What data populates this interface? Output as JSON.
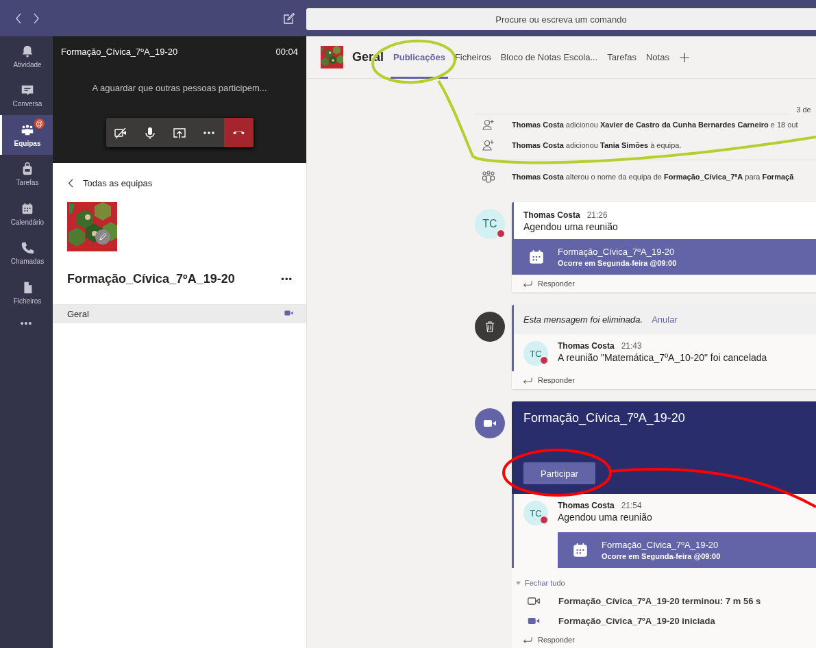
{
  "search": {
    "placeholder": "Procure ou escreva um comando"
  },
  "rail": {
    "items": [
      {
        "label": "Atividade",
        "selected": false
      },
      {
        "label": "Conversa",
        "selected": false
      },
      {
        "label": "Equipas",
        "selected": true,
        "badge": "@"
      },
      {
        "label": "Tarefas",
        "selected": false
      },
      {
        "label": "Calendário",
        "selected": false
      },
      {
        "label": "Chamadas",
        "selected": false
      },
      {
        "label": "Ficheiros",
        "selected": false
      }
    ],
    "more": "•••"
  },
  "call": {
    "title": "Formação_Cívica_7ºA_19-20",
    "timer": "00:04",
    "status": "A aguardar que outras pessoas participem..."
  },
  "team": {
    "back": "Todas as equipas",
    "name": "Formação_Cívica_7ºA_19-20",
    "more": "•••",
    "channels": [
      {
        "name": "Geral",
        "selected": true,
        "in_call": true
      }
    ]
  },
  "channel": {
    "name": "Geral",
    "tabs": [
      {
        "label": "Publicações",
        "selected": true
      },
      {
        "label": "Ficheiros",
        "selected": false
      },
      {
        "label": "Bloco de Notas Escola...",
        "selected": false
      },
      {
        "label": "Tarefas",
        "selected": false
      },
      {
        "label": "Notas",
        "selected": false
      }
    ]
  },
  "feed": {
    "date": "3 de",
    "items": [
      {
        "kind": "member_added",
        "text": "**Thomas Costa** adicionou **Xavier de Castro da Cunha Bernardes Carneiro** e 18 out"
      },
      {
        "kind": "member_added",
        "text": "**Thomas Costa** adicionou **Tania Simões** à equipa."
      },
      {
        "kind": "team_renamed",
        "text": "**Thomas Costa** alterou o nome da equipa de **Formação_Cívica_7ºA** para **Formaçã**"
      },
      {
        "kind": "post",
        "initials": "TC",
        "author": "Thomas Costa",
        "time": "21:26",
        "text": "Agendou uma reunião",
        "meeting": {
          "title": "Formação_Cívica_7ºA_19-20",
          "subtitle": "Ocorre em Segunda-feira @09:00"
        },
        "reply": "Responder"
      },
      {
        "kind": "deleted",
        "text": "Esta mensagem foi eliminada.",
        "undo": "Anular",
        "post": {
          "initials": "TC",
          "author": "Thomas Costa",
          "time": "21:43",
          "text": "A reunião \"Matemática_7ºA_10-20\" foi cancelada"
        },
        "reply": "Responder"
      },
      {
        "kind": "meeting",
        "title": "Formação_Cívica_7ºA_19-20",
        "join": "Participar",
        "post": {
          "initials": "TC",
          "author": "Thomas Costa",
          "time": "21:54",
          "text": "Agendou uma reunião",
          "meeting": {
            "title": "Formação_Cívica_7ºA_19-20",
            "subtitle": "Ocorre em Segunda-feira @09:00"
          }
        },
        "collapse": "Fechar tudo",
        "events": [
          {
            "kind": "ended",
            "text": "Formação_Cívica_7ºA_19-20 terminou: 7 m 56 s"
          },
          {
            "kind": "started",
            "text": "Formação_Cívica_7ºA_19-20 iniciada"
          }
        ],
        "reply": "Responder"
      }
    ]
  }
}
